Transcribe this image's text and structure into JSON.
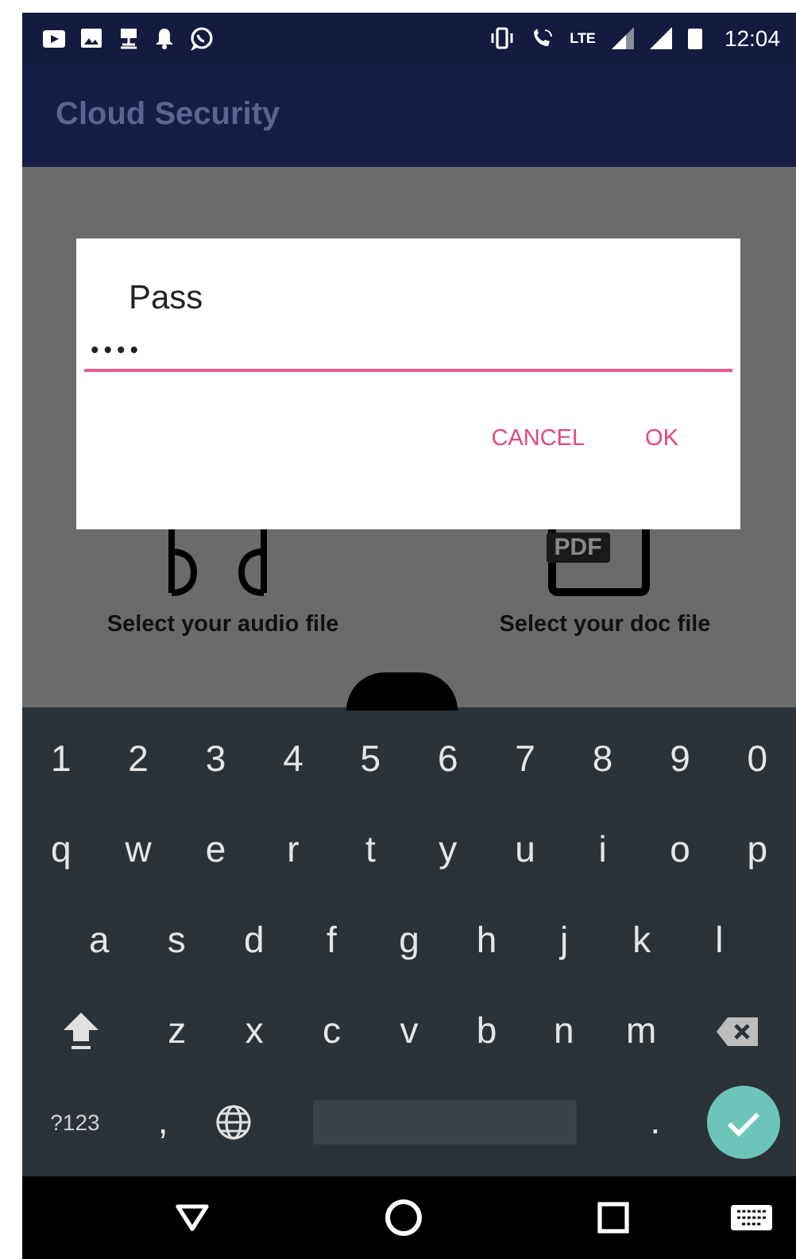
{
  "status_bar": {
    "network": "LTE",
    "time": "12:04"
  },
  "app_bar": {
    "title": "Cloud Security"
  },
  "options": [
    {
      "kind": "audio",
      "label": "Select your audio file"
    },
    {
      "kind": "pdf",
      "badge": "PDF",
      "label": "Select your doc file"
    }
  ],
  "dialog": {
    "title": "Pass",
    "field": {
      "value": "••••"
    },
    "buttons": [
      "CANCEL",
      "OK"
    ]
  },
  "keyboard": {
    "rows": [
      [
        {
          "kind": "char",
          "label": "1"
        },
        {
          "kind": "char",
          "label": "2"
        },
        {
          "kind": "char",
          "label": "3"
        },
        {
          "kind": "char",
          "label": "4"
        },
        {
          "kind": "char",
          "label": "5"
        },
        {
          "kind": "char",
          "label": "6"
        },
        {
          "kind": "char",
          "label": "7"
        },
        {
          "kind": "char",
          "label": "8"
        },
        {
          "kind": "char",
          "label": "9"
        },
        {
          "kind": "char",
          "label": "0"
        }
      ],
      [
        {
          "kind": "char",
          "label": "q"
        },
        {
          "kind": "char",
          "label": "w"
        },
        {
          "kind": "char",
          "label": "e"
        },
        {
          "kind": "char",
          "label": "r"
        },
        {
          "kind": "char",
          "label": "t"
        },
        {
          "kind": "char",
          "label": "y"
        },
        {
          "kind": "char",
          "label": "u"
        },
        {
          "kind": "char",
          "label": "i"
        },
        {
          "kind": "char",
          "label": "o"
        },
        {
          "kind": "char",
          "label": "p"
        }
      ],
      [
        {
          "kind": "char",
          "label": "a"
        },
        {
          "kind": "char",
          "label": "s"
        },
        {
          "kind": "char",
          "label": "d"
        },
        {
          "kind": "char",
          "label": "f"
        },
        {
          "kind": "char",
          "label": "g"
        },
        {
          "kind": "char",
          "label": "h"
        },
        {
          "kind": "char",
          "label": "j"
        },
        {
          "kind": "char",
          "label": "k"
        },
        {
          "kind": "char",
          "label": "l"
        }
      ],
      [
        {
          "kind": "shift"
        },
        {
          "kind": "char",
          "label": "z"
        },
        {
          "kind": "char",
          "label": "x"
        },
        {
          "kind": "char",
          "label": "c"
        },
        {
          "kind": "char",
          "label": "v"
        },
        {
          "kind": "char",
          "label": "b"
        },
        {
          "kind": "char",
          "label": "n"
        },
        {
          "kind": "char",
          "label": "m"
        },
        {
          "kind": "backspace"
        }
      ],
      [
        {
          "kind": "symbols",
          "label": "?123"
        },
        {
          "kind": "char",
          "label": ","
        },
        {
          "kind": "globe"
        },
        {
          "kind": "space"
        },
        {
          "kind": "char",
          "label": "."
        },
        {
          "kind": "enter"
        }
      ]
    ]
  }
}
